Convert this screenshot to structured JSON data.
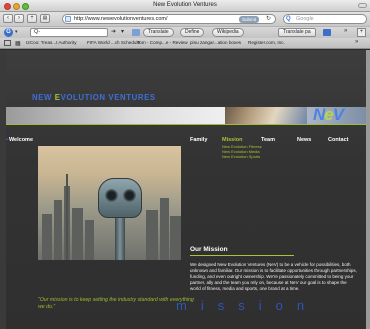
{
  "window": {
    "title": "New Evolution Ventures"
  },
  "navbar": {
    "url": "http://www.newevolutionventures.com/",
    "submit_label": "Submit",
    "search_placeholder": "Google"
  },
  "toolbar": {
    "search_value": "Q-",
    "translate": "Translate",
    "define": "Define",
    "wikipedia": "Wikipedia",
    "translate_page": "Translate pa"
  },
  "bookmarks": [
    "I2Coo: Treas...t Authority",
    "FIFA World ...ch Schedule",
    "Tom - Comp...e - Review",
    "pinu zangar...ation boxes",
    "Register.com, Inc."
  ],
  "site": {
    "logo": {
      "part1": "NEW ",
      "part2": "E",
      "part3": "VOLUTION VENTURES"
    },
    "mark": {
      "n": "N",
      "e": "e",
      "v": "V"
    },
    "nav": {
      "welcome": "Welcome",
      "family": "Family",
      "mission": "Mission",
      "team": "Team",
      "news": "News",
      "contact": "Contact"
    },
    "mission_submenu": [
      "New Evolution Fitness",
      "New Evolution Media",
      "New Evolution Sports"
    ],
    "mission_title": "Our Mission",
    "mission_body": "We designed New Evolution Ventures (NeV) to be a vehicle for possibilities, both unknown and familiar. Our mission is to facilitate opportunities through partnerships, funding, and even outright ownership. We're passionately committed to being your partner, ally and the team you rely on, because at NeV our goal is to shape the world of fitness, media and sports, one brand at a time.",
    "quote": "\"Our mission is to keep setting the industry standard with everything we do.\"",
    "mission_word": "mission"
  },
  "colors": {
    "brand_blue": "#3f6fd6",
    "brand_green": "#a7c33a",
    "background": "#333333"
  }
}
